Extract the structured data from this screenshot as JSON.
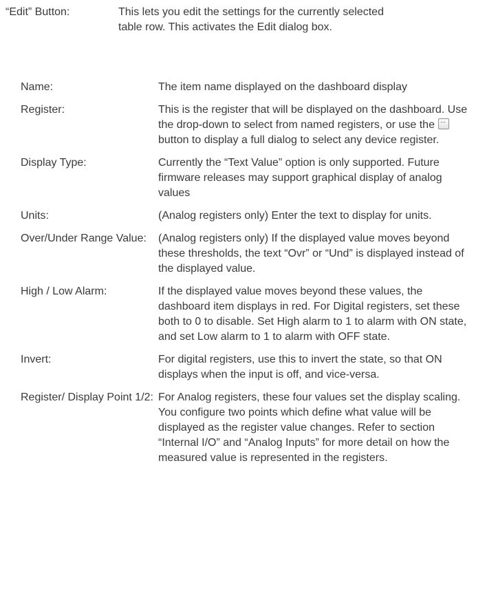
{
  "edit": {
    "term": "“Edit” Button:",
    "description": "This lets you edit the settings for the currently selected table row. This activates the Edit dialog box."
  },
  "definitions": [
    {
      "term": "Name:",
      "description": "The item name displayed on the dashboard display"
    },
    {
      "term": "Register:",
      "description_before": "This is the register that will be displayed on the dashboard. Use the drop-down to select from named registers, or use the ",
      "inline_icon": "ellipsis-button-icon",
      "description_after": " button to display a full dialog to select any device register."
    },
    {
      "term": "Display Type:",
      "description": "Currently the “Text Value” option is only supported. Future firmware releases may support graphical display of analog values"
    },
    {
      "term": "Units:",
      "description": "(Analog registers only) Enter the text to display for units."
    },
    {
      "term": "Over/Under Range Value:",
      "description": "(Analog registers only) If the displayed value moves beyond these thresholds, the text “Ovr” or “Und” is displayed instead of the displayed value."
    },
    {
      "term": "High / Low Alarm:",
      "description": "If the displayed value moves beyond these values, the dashboard item displays in red. For Digital registers, set these both to 0 to disable. Set High alarm to 1 to alarm with ON state, and set Low alarm to 1 to alarm with OFF state."
    },
    {
      "term": "Invert:",
      "description": "For digital registers, use this to invert the state, so that ON displays when the input is off, and vice-versa."
    },
    {
      "term": "Register/ Display Point 1/2:",
      "description": "For Analog registers, these four values set the display scaling. You configure two points which define what value will be displayed as the register value changes. Refer to section “Internal I/O” and “Analog Inputs” for more detail on how the measured value is represented in the registers."
    }
  ]
}
